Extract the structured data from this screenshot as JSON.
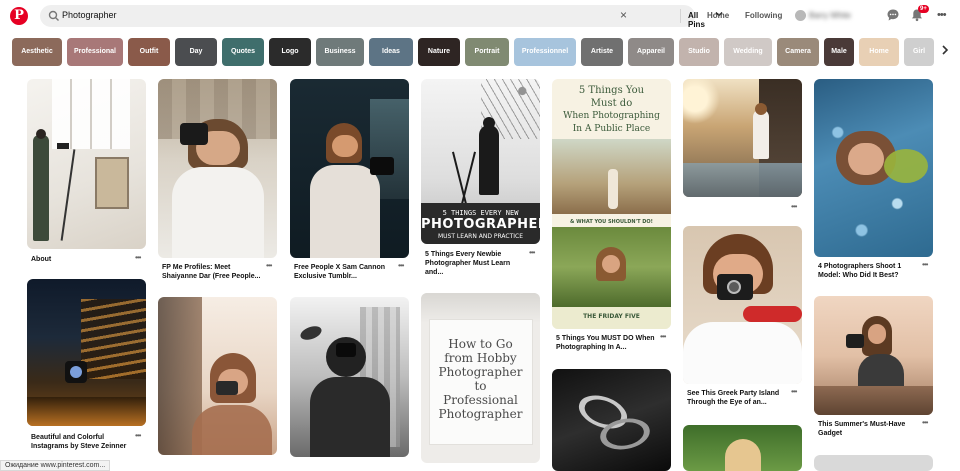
{
  "header": {
    "logo_letter": "P",
    "search_query": "Photographer",
    "search_scope": "All Pins",
    "nav_home": "Home",
    "nav_following": "Following",
    "user_name": "Barry White",
    "notification_count": "9+"
  },
  "chips": [
    {
      "label": "Aesthetic",
      "color": "#8c6a5b"
    },
    {
      "label": "Professional",
      "color": "#a87878"
    },
    {
      "label": "Outfit",
      "color": "#8a5a4a"
    },
    {
      "label": "Day",
      "color": "#4b4d50"
    },
    {
      "label": "Quotes",
      "color": "#3f6e6c"
    },
    {
      "label": "Logo",
      "color": "#2b2b2b"
    },
    {
      "label": "Business",
      "color": "#6f7a7a"
    },
    {
      "label": "Ideas",
      "color": "#5d7485"
    },
    {
      "label": "Nature",
      "color": "#2e2523"
    },
    {
      "label": "Portrait",
      "color": "#808a72"
    },
    {
      "label": "Professionnel",
      "color": "#a7c4dd"
    },
    {
      "label": "Artiste",
      "color": "#707070"
    },
    {
      "label": "Appareil",
      "color": "#8f8a88"
    },
    {
      "label": "Studio",
      "color": "#c2b3ad"
    },
    {
      "label": "Wedding",
      "color": "#d0c9c6"
    },
    {
      "label": "Camera",
      "color": "#9a8a7a"
    },
    {
      "label": "Male",
      "color": "#4a3a38"
    },
    {
      "label": "Home",
      "color": "#e8d0b5"
    },
    {
      "label": "Girl",
      "color": "#cfcfcf"
    }
  ],
  "pins": [
    {
      "caption": "About"
    },
    {
      "caption": "FP Me Profiles: Meet Shaiyanne Dar (Free People..."
    },
    {
      "caption": "Free People X Sam Cannon Exclusive Tumblr..."
    },
    {
      "caption": "5 Things Every Newbie Photographer Must Learn and...",
      "art_lines": [
        "5 THINGS EVERY NEW",
        "PHOTOGRAPHER",
        "MUST LEARN AND PRACTICE"
      ]
    },
    {
      "caption": "5 Things You MUST DO When Photographing In A...",
      "art_lines": [
        "5 Things You",
        "Must do",
        "When Photographing",
        "In A Public Place"
      ],
      "art_sub": "& WHAT YOU SHOULDN'T DO!",
      "art_footer": "THE FRIDAY FIVE"
    },
    {
      "caption": ""
    },
    {
      "caption": "4 Photographers Shoot 1 Model: Who Did It Best?"
    },
    {
      "caption": "Beautiful and Colorful Instagrams by Steve Zeinner"
    },
    {
      "caption": ""
    },
    {
      "caption": ""
    },
    {
      "caption": "",
      "art_lines": [
        "How to Go",
        "from Hobby",
        "Photographer",
        "to",
        "Professional",
        "Photographer"
      ]
    },
    {
      "caption": ""
    },
    {
      "caption": "See This Greek Party Island Through the Eye of an..."
    },
    {
      "caption": "This Summer's Must-Have Gadget"
    },
    {
      "caption": ""
    },
    {
      "caption": ""
    }
  ],
  "status_bar": "Ожидание www.pinterest.com..."
}
